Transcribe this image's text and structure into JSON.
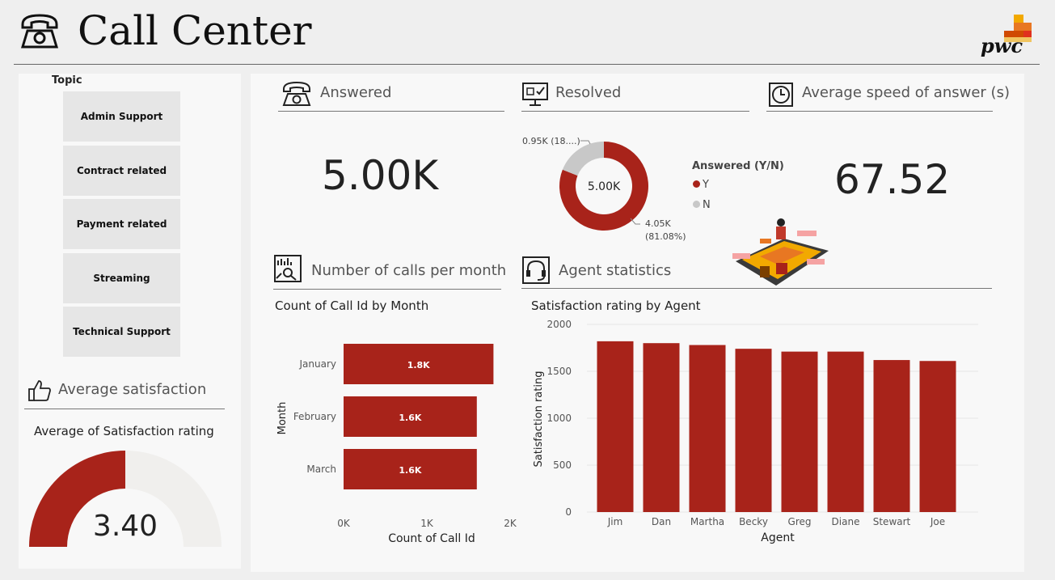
{
  "header": {
    "title": "Call Center",
    "logo_text": "pwc"
  },
  "colors": {
    "accent": "#a8231a",
    "neutral": "#c8c8c8",
    "gauge_track": "#f0efed"
  },
  "slicer": {
    "label": "Topic",
    "items": [
      "Admin Support",
      "Contract related",
      "Payment related",
      "Streaming",
      "Technical Support"
    ]
  },
  "satisfaction": {
    "section_title": "Average satisfaction",
    "chart_title": "Average of Satisfaction rating",
    "value_label": "3.40",
    "value": 3.4,
    "max": 6.8
  },
  "answered": {
    "section_title": "Answered",
    "value": "5.00K"
  },
  "resolved": {
    "section_title": "Resolved",
    "donut_center": "5.00K",
    "legend_title": "Answered (Y/N)",
    "legend": [
      "Y",
      "N"
    ],
    "label_n": "0.95K (18....)",
    "label_y_value": "4.05K",
    "label_y_pct": "(81.08%)"
  },
  "speed": {
    "section_title": "Average speed of answer (s)",
    "value": "67.52"
  },
  "calls_per_month": {
    "section_title": "Number of calls per month",
    "chart_title": "Count of Call Id by Month"
  },
  "agents": {
    "section_title": "Agent statistics",
    "chart_title": "Satisfaction rating by Agent"
  },
  "chart_data": [
    {
      "type": "pie",
      "categories": [
        "Y",
        "N"
      ],
      "values": [
        4050,
        950
      ],
      "legend_title": "Answered (Y/N)",
      "data_labels": [
        "4.05K (81.08%)",
        "0.95K (18....)"
      ]
    },
    {
      "type": "bar",
      "orientation": "horizontal",
      "title": "Count of Call Id by Month",
      "categories": [
        "January",
        "February",
        "March"
      ],
      "values": [
        1800,
        1600,
        1600
      ],
      "data_labels": [
        "1.8K",
        "1.6K",
        "1.6K"
      ],
      "xlabel": "Count of Call Id",
      "ylabel": "Month",
      "xlim": [
        0,
        2000
      ],
      "x_ticks": [
        "0K",
        "1K",
        "2K"
      ]
    },
    {
      "type": "bar",
      "title": "Satisfaction rating by Agent",
      "categories": [
        "Jim",
        "Dan",
        "Martha",
        "Becky",
        "Greg",
        "Diane",
        "Stewart",
        "Joe"
      ],
      "values": [
        1820,
        1800,
        1780,
        1740,
        1710,
        1710,
        1620,
        1610
      ],
      "xlabel": "Agent",
      "ylabel": "Satisfaction rating",
      "ylim": [
        0,
        2000
      ],
      "y_ticks": [
        "0",
        "500",
        "1000",
        "1500",
        "2000"
      ]
    }
  ]
}
